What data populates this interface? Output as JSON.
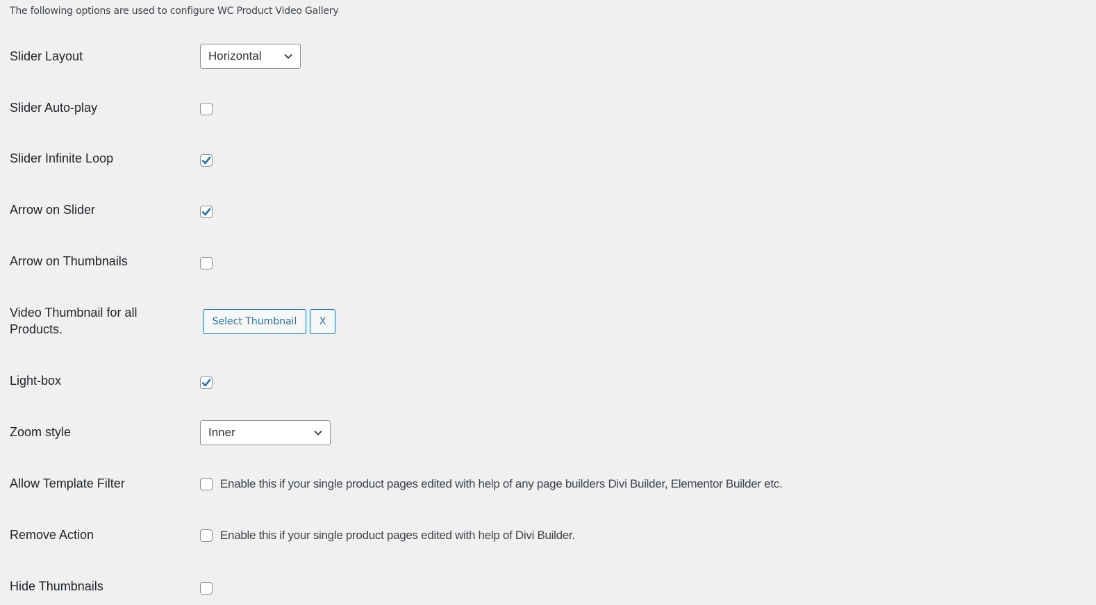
{
  "intro": "The following options are used to configure WC Product Video Gallery",
  "settings": {
    "slider_layout": {
      "label": "Slider Layout",
      "value": "Horizontal"
    },
    "slider_autoplay": {
      "label": "Slider Auto-play",
      "checked": false
    },
    "slider_infinite_loop": {
      "label": "Slider Infinite Loop",
      "checked": true
    },
    "arrow_on_slider": {
      "label": "Arrow on Slider",
      "checked": true
    },
    "arrow_on_thumbnails": {
      "label": "Arrow on Thumbnails",
      "checked": false
    },
    "video_thumbnail": {
      "label": "Video Thumbnail for all Products.",
      "select_button": "Select Thumbnail",
      "remove_button": "X"
    },
    "lightbox": {
      "label": "Light-box",
      "checked": true
    },
    "zoom_style": {
      "label": "Zoom style",
      "value": "Inner"
    },
    "allow_template_filter": {
      "label": "Allow Template Filter",
      "checked": false,
      "description": "Enable this if your single product pages edited with help of any page builders Divi Builder, Elementor Builder etc."
    },
    "remove_action": {
      "label": "Remove Action",
      "checked": false,
      "description": "Enable this if your single product pages edited with help of Divi Builder."
    },
    "hide_thumbnails": {
      "label": "Hide Thumbnails",
      "checked": false
    }
  },
  "colors": {
    "accent": "#2271b1",
    "background": "#f0f0f1"
  }
}
